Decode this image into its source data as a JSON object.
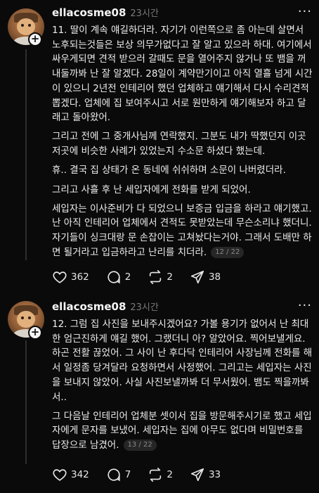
{
  "posts": [
    {
      "username": "ellacosme08",
      "time": "23시간",
      "more": "···",
      "paragraphs": [
        "11. 딸이 계속 얘길하더라. 자기가 이런쪽으로 좀 아는데 살면서 노후되는것들은 보상 의무가없다고 잘 알고 있으라 하대. 여기에서 싸우게되면 견적 받으러 갈때도 문을 열어주지 않거나 또 뱀을 꺼내둘까봐 난 잘 알겠다. 28일이 계약만기이고 아직 열흘 넘게 시간이 있으니 2년전 인테리어 했던 업체하고 얘기해서 다시 수리견적 뽑겠다. 업체에 집 보여주시고 서로 원만하게 얘기해보자 하고 달래고 돌아왔어.",
        "그리고 전에 그 중개사님께 연락했지. 그분도 내가 딱했던지 이곳저곳에 비슷한 사례가 있었는지 수소문 하셨다 했는데.",
        "휴.. 결국 집 상태가 온 동네에 쉬쉬하며 소문이 나버렸더라.",
        "그리고 사흘 후 난 세입자에게 전화를 받게 되었어.",
        "세입자는 이사준비가 다 되었으니 보증금 입금을 하라고 얘기했고. 난 아직 인테리어 업체에서 견적도 못받았는데 무슨소리냐 했더니. 자기들이 싱크대랑 문 손잡이는 고쳐놨다는거야. 그래서 도배만 하면 될거라고 입금하라고 난리를 치더라."
      ],
      "page": "12 / 22",
      "likes": "362",
      "comments": "2",
      "reposts": "2",
      "shares": "38"
    },
    {
      "username": "ellacosme08",
      "time": "23시간",
      "more": "···",
      "paragraphs": [
        "12. 그럼 집 사진을 보내주시겠어요? 가볼 용기가 없어서 난 최대한 엄근진하게 얘길 했어. 그랬더니 아? 알았어요. 찍어보낼게요. 하곤 전활 끊었어. 그 사이 난 후다닥 인테리어 사장님께 전화를 해서 일정좀 당겨달라 요청하면서 사정했어. 그리고는 세입자는 사진을 보내지 않았어. 사실 사진보낼까봐 더 무서웠어. 뱀도 찍을까봐서..",
        "그 다음날 인테리어 업체분 셋이서 집을 방문해주시기로 했고 세입자에게 문자를 보냈어. 세입자는 집에 아무도 없다며 비밀번호를 답장으로 남겼어."
      ],
      "page": "13 / 22",
      "likes": "342",
      "comments": "7",
      "reposts": "2",
      "shares": "33"
    }
  ],
  "icons": {
    "like": "heart-icon",
    "comment": "comment-icon",
    "repost": "repost-icon",
    "share": "share-icon",
    "follow": "plus-icon"
  },
  "colors": {
    "background": "#0a0a0a",
    "text": "#ededed",
    "muted": "#7a7a7a"
  }
}
